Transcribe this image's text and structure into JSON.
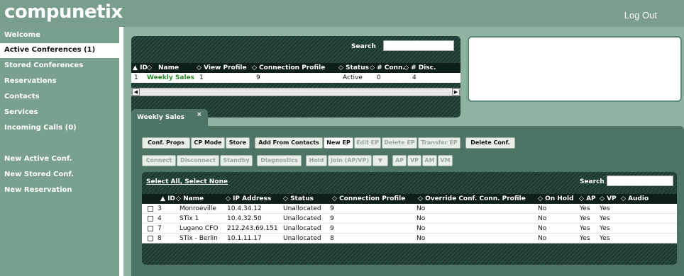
{
  "header": {
    "logo": "compunetix",
    "logout_label": "Log Out"
  },
  "sidebar": {
    "items": [
      {
        "label": "Welcome",
        "active": false
      },
      {
        "label": "Active Conferences (1)",
        "active": true
      },
      {
        "label": "Stored Conferences",
        "active": false
      },
      {
        "label": "Reservations",
        "active": false
      },
      {
        "label": "Contacts",
        "active": false
      },
      {
        "label": "Services",
        "active": false
      },
      {
        "label": "Incoming Calls (0)",
        "active": false
      }
    ],
    "actions": [
      {
        "label": "New Active Conf."
      },
      {
        "label": "New Stored Conf."
      },
      {
        "label": "New Reservation"
      }
    ]
  },
  "conferences": {
    "search_label": "Search",
    "search_value": "",
    "columns": [
      "ID",
      "Name",
      "View Profile",
      "Connection Profile",
      "Status",
      "# Conn.",
      "# Disc."
    ],
    "rows": [
      {
        "id": "1",
        "name": "Weekly Sales",
        "view_profile": "1",
        "connection_profile": "9",
        "status": "Active",
        "conn": "0",
        "disc": "4"
      }
    ]
  },
  "tab": {
    "label": "Weekly Sales",
    "close": "×"
  },
  "toolbar1": [
    "Conf. Props",
    "CP Mode",
    "Store",
    "Add From Contacts",
    "New EP",
    "Edit EP",
    "Delete EP",
    "Transfer EP",
    "Delete Conf."
  ],
  "toolbar2": [
    "Connect",
    "Disconnect",
    "Standby",
    "Diagnostics",
    "Hold",
    "Join (AP/VP)",
    "▼",
    "AP",
    "VP",
    "AM",
    "VM"
  ],
  "endpoints": {
    "select_all": "Select All",
    "separator": ",",
    "select_none": "Select None",
    "search_label": "Search",
    "search_value": "",
    "columns": [
      "ID",
      "Name",
      "IP Address",
      "Status",
      "Connection Profile",
      "Override Conf. Conn. Profile",
      "On Hold",
      "AP",
      "VP",
      "Audio"
    ],
    "rows": [
      {
        "id": "3",
        "name": "Monroeville",
        "ip": "10.4.34.12",
        "status": "Unallocated",
        "conn_profile": "9",
        "override": "No",
        "on_hold": "No",
        "ap": "Yes",
        "vp": "Yes"
      },
      {
        "id": "4",
        "name": "STix 1",
        "ip": "10.4.32.50",
        "status": "Unallocated",
        "conn_profile": "9",
        "override": "No",
        "on_hold": "No",
        "ap": "Yes",
        "vp": "Yes"
      },
      {
        "id": "7",
        "name": "Lugano CFO",
        "ip": "212.243.69.151",
        "status": "Unallocated",
        "conn_profile": "9",
        "override": "No",
        "on_hold": "No",
        "ap": "Yes",
        "vp": "Yes"
      },
      {
        "id": "8",
        "name": "STix - Berlin",
        "ip": "10.1.11.17",
        "status": "Unallocated",
        "conn_profile": "8",
        "override": "No",
        "on_hold": "No",
        "ap": "Yes",
        "vp": "Yes"
      }
    ]
  },
  "colors": {
    "sidebar": "#7aa08f",
    "panel_dark": "#1f3d35",
    "accent_green": "#2a8a2a"
  }
}
